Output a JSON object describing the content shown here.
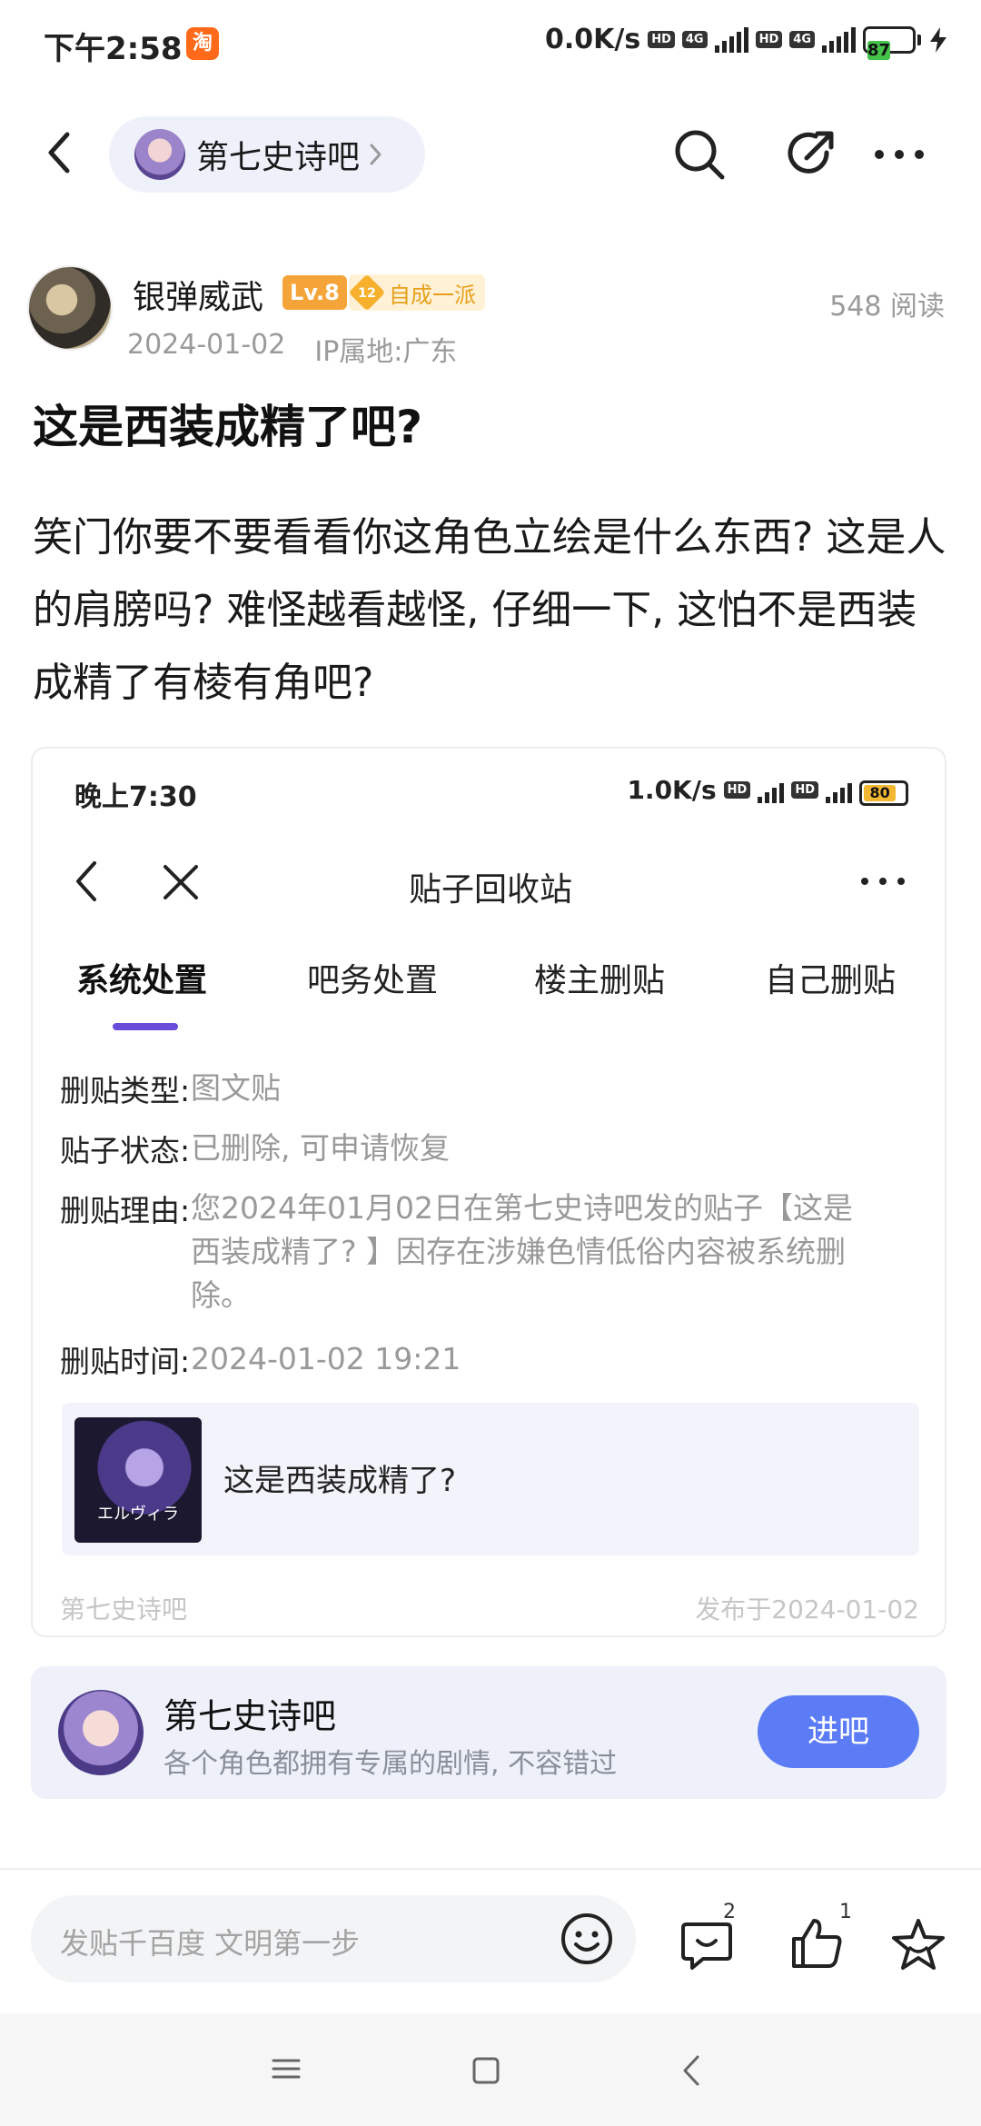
{
  "status_bar": {
    "time": "下午2:58",
    "taobao_badge": "淘",
    "speed": "0.0K/s",
    "network_hd": "HD",
    "network_4g": "4G",
    "battery": "87"
  },
  "top_nav": {
    "forum_name": "第七史诗吧",
    "icons": [
      "back-icon",
      "chevron-right-icon",
      "search-icon",
      "share-icon",
      "more-icon"
    ]
  },
  "author": {
    "name": "银弹威武",
    "level": "Lv.8",
    "rank_num": "12",
    "rank_title": "自成一派",
    "date": "2024-01-02",
    "ip": "IP属地:广东",
    "reads": "548 阅读"
  },
  "post": {
    "title": "这是西装成精了吧?",
    "body": "笑门你要不要看看你这角色立绘是什么东西? 这是人的肩膀吗? 难怪越看越怪, 仔细一下, 这怕不是西装成精了有棱有角吧?"
  },
  "embed": {
    "time": "晚上7:30",
    "speed": "1.0K/s",
    "battery": "80",
    "nav_title": "贴子回收站",
    "tabs": [
      "系统处置",
      "吧务处置",
      "楼主删贴",
      "自己删贴"
    ],
    "rows": [
      {
        "key": "删贴类型:",
        "value": "图文贴"
      },
      {
        "key": "贴子状态:",
        "value": "已删除, 可申请恢复"
      },
      {
        "key": "删贴理由:",
        "value": "您2024年01月02日在第七史诗吧发的贴子【这是西装成精了? 】因存在涉嫌色情低俗内容被系统删除。"
      },
      {
        "key": "删贴时间:",
        "value": "2024-01-02 19:21"
      }
    ],
    "card_title": "这是西装成精了?",
    "thumb_text": "エルヴィラ",
    "footer_forum": "第七史诗吧",
    "footer_date": "发布于2024-01-02"
  },
  "forum_card": {
    "name": "第七史诗吧",
    "description": "各个角色都拥有专属的剧情, 不容错过",
    "enter_label": "进吧"
  },
  "bottom_bar": {
    "placeholder": "发贴千百度 文明第一步",
    "comment_count": "2",
    "like_count": "1"
  },
  "colors": {
    "accent": "#5b7cf5",
    "tab_underline": "#6a4cdb",
    "level_badge": "#f5a43a",
    "rank_text": "#e6a01b",
    "battery_green": "#44c24a"
  }
}
